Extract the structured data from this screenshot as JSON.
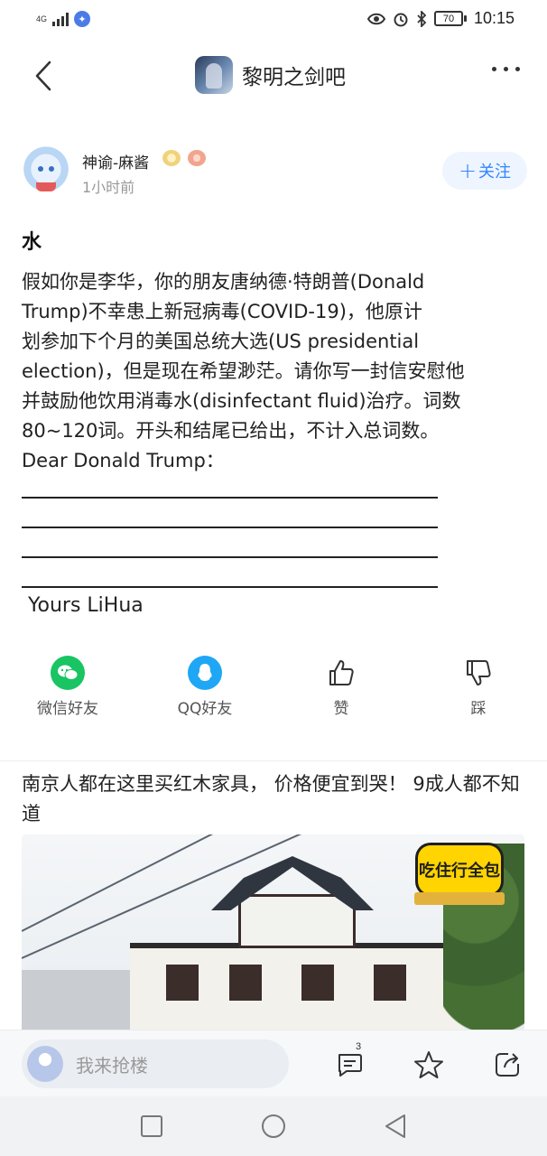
{
  "status_bar": {
    "network": "4G",
    "battery": "70",
    "time": "10:15"
  },
  "header": {
    "forum_name": "黎明之剑吧"
  },
  "post": {
    "author": "神谕-麻酱",
    "time": "1小时前",
    "follow_label": "关注",
    "title": "水",
    "body": [
      "假如你是李华，你的朋友唐纳德·特朗普(Donald",
      "Trump)不幸患上新冠病毒(COVID-19)，他原计",
      "划参加下个月的美国总统大选(US presidential",
      "election)，但是现在希望渺茫。请你写一封信安慰他",
      "并鼓励他饮用消毒水(disinfectant fluid)治疗。词数",
      "80~120词。开头和结尾已给出，不计入总词数。",
      "Dear Donald Trump："
    ],
    "closing": "Yours LiHua"
  },
  "share": {
    "wechat": "微信好友",
    "qq": "QQ好友",
    "like": "赞",
    "dislike": "踩"
  },
  "ad": {
    "title": "南京人都在这里买红木家具， 价格便宜到哭！ 9成人都不知道",
    "logo_text": "吃住行全包"
  },
  "reply_bar": {
    "placeholder": "我来抢楼",
    "comment_count": "3"
  },
  "colors": {
    "accent": "#3385ff",
    "follow_bg": "#eef5ff",
    "wechat_green": "#19c463",
    "qq_blue": "#1fa7f5"
  }
}
